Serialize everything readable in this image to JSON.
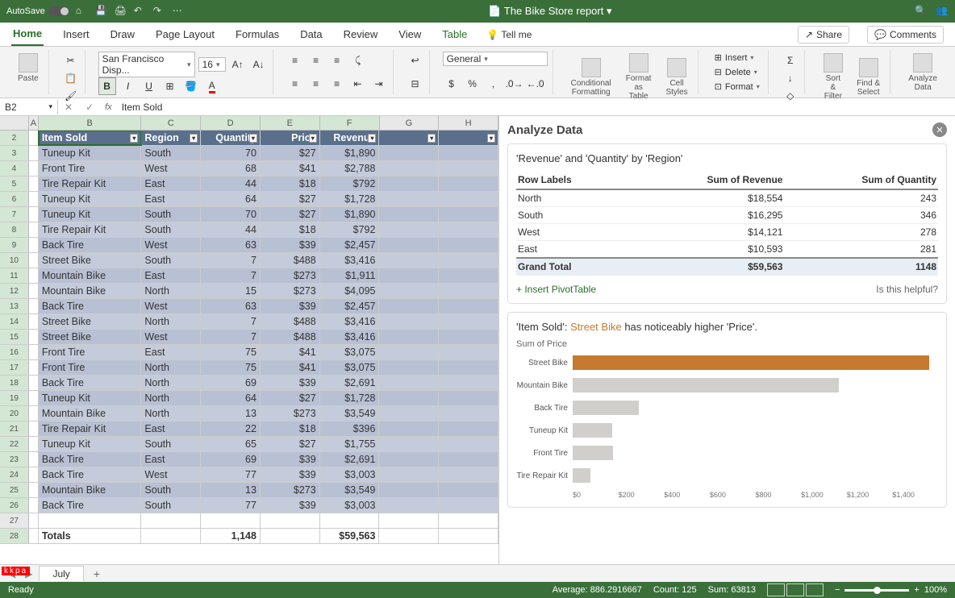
{
  "titlebar": {
    "autosave": "AutoSave",
    "doc": "The Bike Store report"
  },
  "tabs": [
    "Home",
    "Insert",
    "Draw",
    "Page Layout",
    "Formulas",
    "Data",
    "Review",
    "View",
    "Table"
  ],
  "tellme": "Tell me",
  "share": "Share",
  "comments": "Comments",
  "ribbon": {
    "paste": "Paste",
    "font_name": "San Francisco Disp...",
    "font_size": "16",
    "number_format": "General",
    "cond_fmt": "Conditional Formatting",
    "as_table": "Format as Table",
    "styles": "Cell Styles",
    "insert": "Insert",
    "delete": "Delete",
    "format": "Format",
    "sort": "Sort & Filter",
    "find": "Find & Select",
    "analyze": "Analyze Data"
  },
  "formula": {
    "name": "B2",
    "value": "Item Sold"
  },
  "cols": [
    "A",
    "B",
    "C",
    "D",
    "E",
    "F",
    "G",
    "H"
  ],
  "headers": [
    "Item Sold",
    "Region",
    "Quantity",
    "Price",
    "Revenue"
  ],
  "rows": [
    {
      "n": 3,
      "d": [
        "Tuneup Kit",
        "South",
        "70",
        "$27",
        "$1,890"
      ]
    },
    {
      "n": 4,
      "d": [
        "Front Tire",
        "West",
        "68",
        "$41",
        "$2,788"
      ]
    },
    {
      "n": 5,
      "d": [
        "Tire Repair Kit",
        "East",
        "44",
        "$18",
        "$792"
      ]
    },
    {
      "n": 6,
      "d": [
        "Tuneup Kit",
        "East",
        "64",
        "$27",
        "$1,728"
      ]
    },
    {
      "n": 7,
      "d": [
        "Tuneup Kit",
        "South",
        "70",
        "$27",
        "$1,890"
      ]
    },
    {
      "n": 8,
      "d": [
        "Tire Repair Kit",
        "South",
        "44",
        "$18",
        "$792"
      ]
    },
    {
      "n": 9,
      "d": [
        "Back Tire",
        "West",
        "63",
        "$39",
        "$2,457"
      ]
    },
    {
      "n": 10,
      "d": [
        "Street Bike",
        "South",
        "7",
        "$488",
        "$3,416"
      ]
    },
    {
      "n": 11,
      "d": [
        "Mountain Bike",
        "East",
        "7",
        "$273",
        "$1,911"
      ]
    },
    {
      "n": 12,
      "d": [
        "Mountain Bike",
        "North",
        "15",
        "$273",
        "$4,095"
      ]
    },
    {
      "n": 13,
      "d": [
        "Back Tire",
        "West",
        "63",
        "$39",
        "$2,457"
      ]
    },
    {
      "n": 14,
      "d": [
        "Street Bike",
        "North",
        "7",
        "$488",
        "$3,416"
      ]
    },
    {
      "n": 15,
      "d": [
        "Street Bike",
        "West",
        "7",
        "$488",
        "$3,416"
      ]
    },
    {
      "n": 16,
      "d": [
        "Front Tire",
        "East",
        "75",
        "$41",
        "$3,075"
      ]
    },
    {
      "n": 17,
      "d": [
        "Front Tire",
        "North",
        "75",
        "$41",
        "$3,075"
      ]
    },
    {
      "n": 18,
      "d": [
        "Back Tire",
        "North",
        "69",
        "$39",
        "$2,691"
      ]
    },
    {
      "n": 19,
      "d": [
        "Tuneup Kit",
        "North",
        "64",
        "$27",
        "$1,728"
      ]
    },
    {
      "n": 20,
      "d": [
        "Mountain Bike",
        "North",
        "13",
        "$273",
        "$3,549"
      ]
    },
    {
      "n": 21,
      "d": [
        "Tire Repair Kit",
        "East",
        "22",
        "$18",
        "$396"
      ]
    },
    {
      "n": 22,
      "d": [
        "Tuneup Kit",
        "South",
        "65",
        "$27",
        "$1,755"
      ]
    },
    {
      "n": 23,
      "d": [
        "Back Tire",
        "East",
        "69",
        "$39",
        "$2,691"
      ]
    },
    {
      "n": 24,
      "d": [
        "Back Tire",
        "West",
        "77",
        "$39",
        "$3,003"
      ]
    },
    {
      "n": 25,
      "d": [
        "Mountain Bike",
        "South",
        "13",
        "$273",
        "$3,549"
      ]
    },
    {
      "n": 26,
      "d": [
        "Back Tire",
        "South",
        "77",
        "$39",
        "$3,003"
      ]
    }
  ],
  "totals": {
    "n": 28,
    "label": "Totals",
    "qty": "1,148",
    "rev": "$59,563"
  },
  "pane": {
    "title": "Analyze Data",
    "insight1_title": "'Revenue' and 'Quantity' by 'Region'",
    "pivot_headers": [
      "Row Labels",
      "Sum of Revenue",
      "Sum of Quantity"
    ],
    "pivot_rows": [
      [
        "North",
        "$18,554",
        "243"
      ],
      [
        "South",
        "$16,295",
        "346"
      ],
      [
        "West",
        "$14,121",
        "278"
      ],
      [
        "East",
        "$10,593",
        "281"
      ]
    ],
    "pivot_total": [
      "Grand Total",
      "$59,563",
      "1148"
    ],
    "insert_pt": "Insert PivotTable",
    "helpful": "Is this helpful?",
    "insight2_pre": "'Item Sold': ",
    "insight2_hl": "Street Bike",
    "insight2_post": " has noticeably higher 'Price'.",
    "chart_sub": "Sum of Price",
    "axis": [
      "$0",
      "$200",
      "$400",
      "$600",
      "$800",
      "$1,000",
      "$1,200",
      "$1,400"
    ]
  },
  "chart_data": {
    "type": "bar",
    "title": "Sum of Price",
    "xlabel": "",
    "ylabel": "",
    "categories": [
      "Street Bike",
      "Mountain Bike",
      "Back Tire",
      "Tuneup Kit",
      "Front Tire",
      "Tire Repair Kit"
    ],
    "values": [
      1464,
      1092,
      273,
      162,
      164,
      72
    ],
    "xlim": [
      0,
      1500
    ],
    "highlight": "Street Bike"
  },
  "sheet_tab": "July",
  "status": {
    "ready": "Ready",
    "avg": "Average: 886.2916667",
    "count": "Count: 125",
    "sum": "Sum: 63813",
    "zoom": "100%"
  }
}
